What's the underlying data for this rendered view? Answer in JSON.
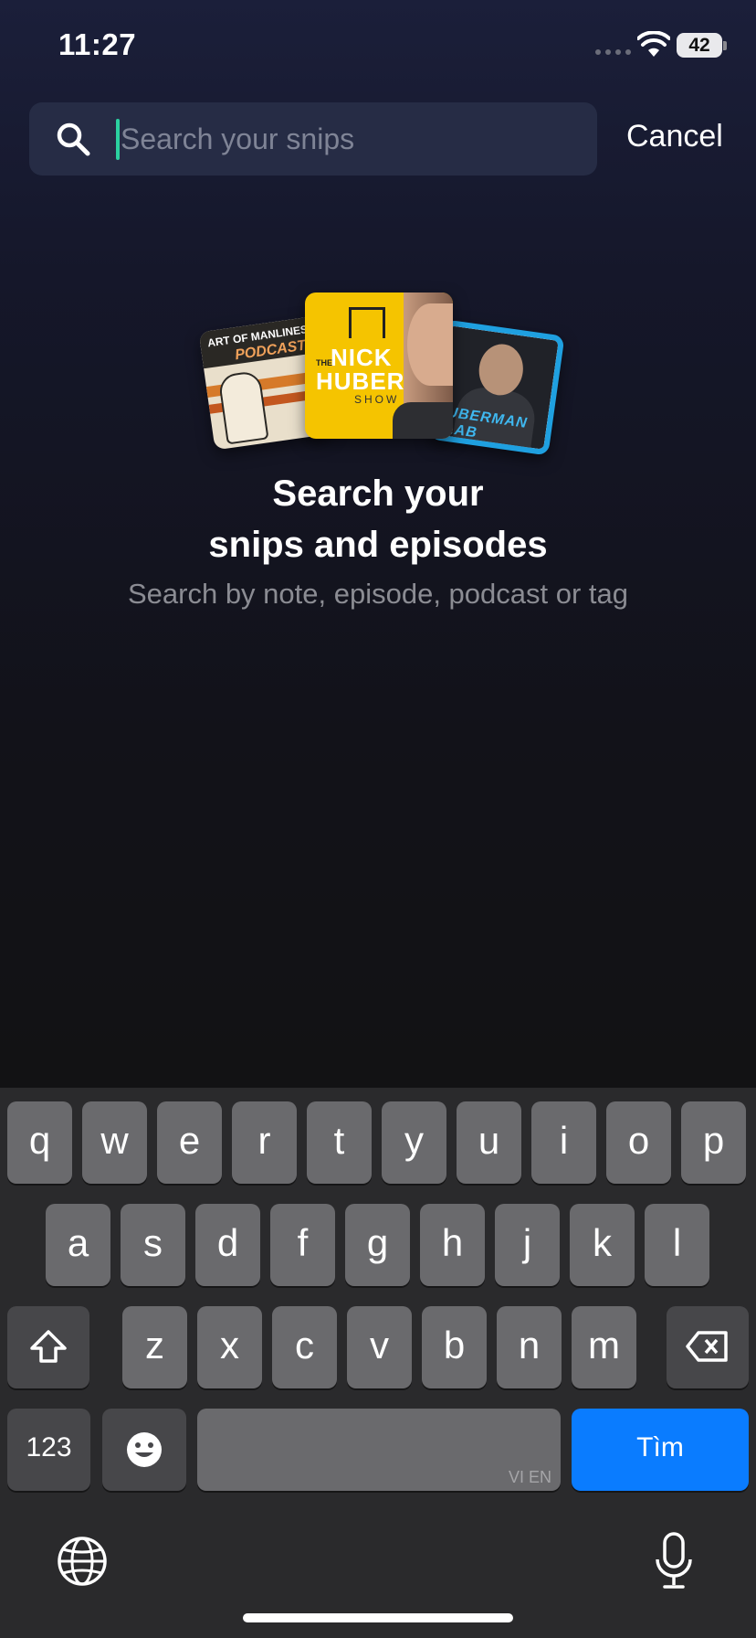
{
  "status_bar": {
    "time": "11:27",
    "battery": "42"
  },
  "search": {
    "placeholder": "Search your snips",
    "value": "",
    "cancel_label": "Cancel"
  },
  "artwork": {
    "art_of_manliness": {
      "line1": "ART OF MANLINESS",
      "line2": "PODCAST"
    },
    "nick_huber": {
      "the": "THE",
      "line1": "NICK",
      "line2": "HUBER",
      "line3": "SHOW"
    },
    "huberman": {
      "line1": "UBERMAN",
      "line2": "LAB"
    }
  },
  "empty_state": {
    "title_line1": "Search your",
    "title_line2": "snips and episodes",
    "subtitle": "Search by note, episode, podcast or tag"
  },
  "keyboard": {
    "row1": [
      "q",
      "w",
      "e",
      "r",
      "t",
      "y",
      "u",
      "i",
      "o",
      "p"
    ],
    "row2": [
      "a",
      "s",
      "d",
      "f",
      "g",
      "h",
      "j",
      "k",
      "l"
    ],
    "row3": [
      "z",
      "x",
      "c",
      "v",
      "b",
      "n",
      "m"
    ],
    "numbers_label": "123",
    "space_hint": "VI EN",
    "return_label": "Tìm"
  },
  "colors": {
    "accent": "#2bd1a0",
    "return_key": "#0a7cff"
  }
}
